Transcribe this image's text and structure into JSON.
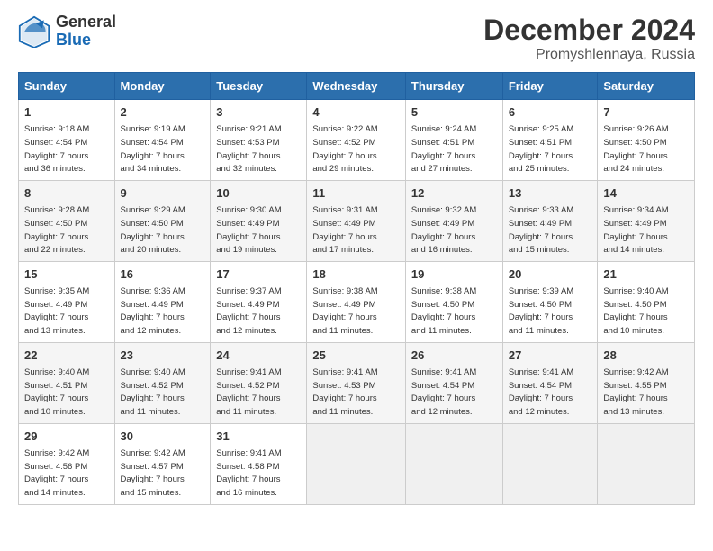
{
  "header": {
    "logo_general": "General",
    "logo_blue": "Blue",
    "month_title": "December 2024",
    "location": "Promyshlennaya, Russia"
  },
  "days_of_week": [
    "Sunday",
    "Monday",
    "Tuesday",
    "Wednesday",
    "Thursday",
    "Friday",
    "Saturday"
  ],
  "weeks": [
    [
      {
        "day": "1",
        "info": "Sunrise: 9:18 AM\nSunset: 4:54 PM\nDaylight: 7 hours\nand 36 minutes."
      },
      {
        "day": "2",
        "info": "Sunrise: 9:19 AM\nSunset: 4:54 PM\nDaylight: 7 hours\nand 34 minutes."
      },
      {
        "day": "3",
        "info": "Sunrise: 9:21 AM\nSunset: 4:53 PM\nDaylight: 7 hours\nand 32 minutes."
      },
      {
        "day": "4",
        "info": "Sunrise: 9:22 AM\nSunset: 4:52 PM\nDaylight: 7 hours\nand 29 minutes."
      },
      {
        "day": "5",
        "info": "Sunrise: 9:24 AM\nSunset: 4:51 PM\nDaylight: 7 hours\nand 27 minutes."
      },
      {
        "day": "6",
        "info": "Sunrise: 9:25 AM\nSunset: 4:51 PM\nDaylight: 7 hours\nand 25 minutes."
      },
      {
        "day": "7",
        "info": "Sunrise: 9:26 AM\nSunset: 4:50 PM\nDaylight: 7 hours\nand 24 minutes."
      }
    ],
    [
      {
        "day": "8",
        "info": "Sunrise: 9:28 AM\nSunset: 4:50 PM\nDaylight: 7 hours\nand 22 minutes."
      },
      {
        "day": "9",
        "info": "Sunrise: 9:29 AM\nSunset: 4:50 PM\nDaylight: 7 hours\nand 20 minutes."
      },
      {
        "day": "10",
        "info": "Sunrise: 9:30 AM\nSunset: 4:49 PM\nDaylight: 7 hours\nand 19 minutes."
      },
      {
        "day": "11",
        "info": "Sunrise: 9:31 AM\nSunset: 4:49 PM\nDaylight: 7 hours\nand 17 minutes."
      },
      {
        "day": "12",
        "info": "Sunrise: 9:32 AM\nSunset: 4:49 PM\nDaylight: 7 hours\nand 16 minutes."
      },
      {
        "day": "13",
        "info": "Sunrise: 9:33 AM\nSunset: 4:49 PM\nDaylight: 7 hours\nand 15 minutes."
      },
      {
        "day": "14",
        "info": "Sunrise: 9:34 AM\nSunset: 4:49 PM\nDaylight: 7 hours\nand 14 minutes."
      }
    ],
    [
      {
        "day": "15",
        "info": "Sunrise: 9:35 AM\nSunset: 4:49 PM\nDaylight: 7 hours\nand 13 minutes."
      },
      {
        "day": "16",
        "info": "Sunrise: 9:36 AM\nSunset: 4:49 PM\nDaylight: 7 hours\nand 12 minutes."
      },
      {
        "day": "17",
        "info": "Sunrise: 9:37 AM\nSunset: 4:49 PM\nDaylight: 7 hours\nand 12 minutes."
      },
      {
        "day": "18",
        "info": "Sunrise: 9:38 AM\nSunset: 4:49 PM\nDaylight: 7 hours\nand 11 minutes."
      },
      {
        "day": "19",
        "info": "Sunrise: 9:38 AM\nSunset: 4:50 PM\nDaylight: 7 hours\nand 11 minutes."
      },
      {
        "day": "20",
        "info": "Sunrise: 9:39 AM\nSunset: 4:50 PM\nDaylight: 7 hours\nand 11 minutes."
      },
      {
        "day": "21",
        "info": "Sunrise: 9:40 AM\nSunset: 4:50 PM\nDaylight: 7 hours\nand 10 minutes."
      }
    ],
    [
      {
        "day": "22",
        "info": "Sunrise: 9:40 AM\nSunset: 4:51 PM\nDaylight: 7 hours\nand 10 minutes."
      },
      {
        "day": "23",
        "info": "Sunrise: 9:40 AM\nSunset: 4:52 PM\nDaylight: 7 hours\nand 11 minutes."
      },
      {
        "day": "24",
        "info": "Sunrise: 9:41 AM\nSunset: 4:52 PM\nDaylight: 7 hours\nand 11 minutes."
      },
      {
        "day": "25",
        "info": "Sunrise: 9:41 AM\nSunset: 4:53 PM\nDaylight: 7 hours\nand 11 minutes."
      },
      {
        "day": "26",
        "info": "Sunrise: 9:41 AM\nSunset: 4:54 PM\nDaylight: 7 hours\nand 12 minutes."
      },
      {
        "day": "27",
        "info": "Sunrise: 9:41 AM\nSunset: 4:54 PM\nDaylight: 7 hours\nand 12 minutes."
      },
      {
        "day": "28",
        "info": "Sunrise: 9:42 AM\nSunset: 4:55 PM\nDaylight: 7 hours\nand 13 minutes."
      }
    ],
    [
      {
        "day": "29",
        "info": "Sunrise: 9:42 AM\nSunset: 4:56 PM\nDaylight: 7 hours\nand 14 minutes."
      },
      {
        "day": "30",
        "info": "Sunrise: 9:42 AM\nSunset: 4:57 PM\nDaylight: 7 hours\nand 15 minutes."
      },
      {
        "day": "31",
        "info": "Sunrise: 9:41 AM\nSunset: 4:58 PM\nDaylight: 7 hours\nand 16 minutes."
      },
      null,
      null,
      null,
      null
    ]
  ]
}
